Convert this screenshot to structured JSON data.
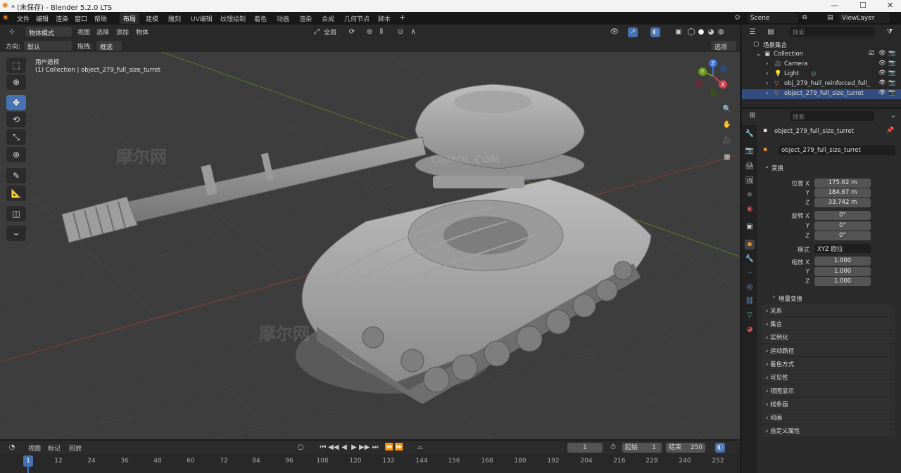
{
  "window": {
    "title": "* (未保存) - Blender 5.2.0 LTS",
    "minimize": "—",
    "maximize": "☐",
    "close": "✕"
  },
  "menu": {
    "items": [
      "文件",
      "编辑",
      "渲染",
      "窗口",
      "帮助"
    ],
    "workspaces": [
      "布局",
      "建模",
      "雕刻",
      "UV编辑",
      "纹理绘制",
      "着色",
      "动画",
      "渲染",
      "合成",
      "几何节点",
      "脚本"
    ],
    "active_workspace": "布局",
    "scene": "Scene",
    "view_layer": "ViewLayer"
  },
  "viewport": {
    "mode": "物体模式",
    "menus": [
      "视图",
      "选择",
      "添加",
      "物体"
    ],
    "transform_orientation": "全局",
    "orientation_label": "方向:",
    "orientation_value": "默认",
    "drag_label": "拖拽:",
    "drag_value": "框选",
    "options": "选项",
    "view_name": "用户透视",
    "view_info": "(1) Collection | object_279_full_size_turret",
    "watermark": "摩尔网",
    "watermark_url": "CGMOL.COM",
    "gizmo": {
      "x": "X",
      "y": "Y",
      "z": "Z"
    }
  },
  "outliner": {
    "search_placeholder": "搜索",
    "root": "场景集合",
    "collection": "Collection",
    "items": [
      "Camera",
      "Light",
      "obj_279_hull_reinforced_full_",
      "object_279_full_size_turret"
    ]
  },
  "properties": {
    "search_placeholder": "搜索",
    "object_name": "object_279_full_size_turret",
    "object_field": "object_279_full_size_turret",
    "transform_title": "变换",
    "location_label": "位置 X",
    "loc": [
      "175.62 m",
      "184.67 m",
      "33.742 m"
    ],
    "rotation_label": "旋转 X",
    "rot": [
      "0°",
      "0°",
      "0°"
    ],
    "mode_label": "模式",
    "mode_value": "XYZ 欧拉",
    "scale_label": "缩放 X",
    "scale": [
      "1.000",
      "1.000",
      "1.000"
    ],
    "axis_y": "Y",
    "axis_z": "Z",
    "delta": "增量变换",
    "sections": [
      "关系",
      "集合",
      "实例化",
      "运动路径",
      "着色方式",
      "可见性",
      "视图显示",
      "线条画",
      "动画",
      "自定义属性"
    ]
  },
  "timeline": {
    "menus": [
      "视图",
      "标记",
      "回放"
    ],
    "current_frame": "1",
    "start_label": "起始",
    "start": "1",
    "end_label": "结束",
    "end": "250",
    "ticks": [
      "1",
      "12",
      "24",
      "36",
      "48",
      "60",
      "72",
      "84",
      "96",
      "108",
      "120",
      "132",
      "144",
      "156",
      "168",
      "180",
      "192",
      "204",
      "216",
      "228",
      "240",
      "252"
    ]
  },
  "colors": {
    "accent": "#4772b3",
    "viewport_bg": "#3d3d3d",
    "panel": "#282828",
    "selected": "#334d80"
  }
}
